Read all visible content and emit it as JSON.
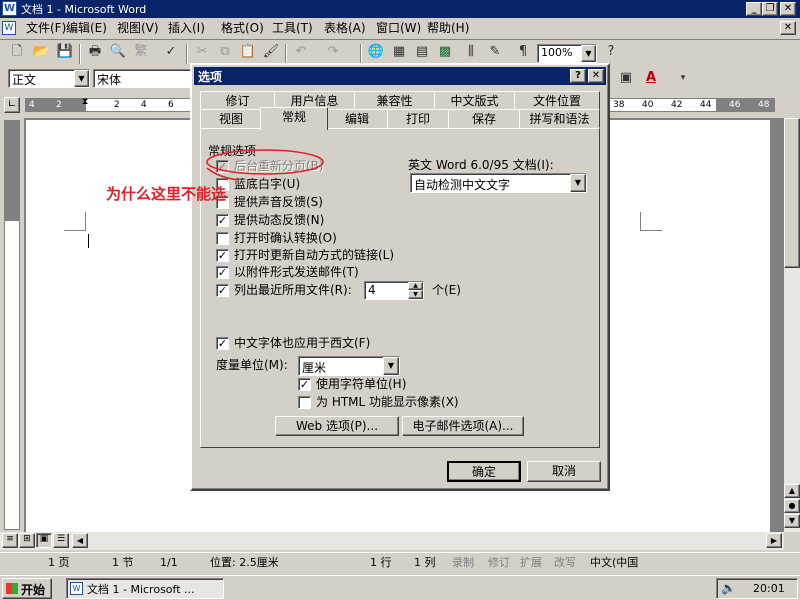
{
  "window": {
    "title": "文档 1 - Microsoft Word"
  },
  "menu": [
    "文件(F)",
    "编辑(E)",
    "视图(V)",
    "插入(I)",
    "格式(O)",
    "工具(T)",
    "表格(A)",
    "窗口(W)",
    "帮助(H)"
  ],
  "toolbar": {
    "zoom": "100%",
    "style": "正文",
    "font": "宋体"
  },
  "ruler": {
    "left_ticks": [
      "4",
      "2",
      "2",
      "4",
      "6"
    ],
    "right_ticks": [
      "38",
      "40",
      "42",
      "44",
      "46",
      "48"
    ]
  },
  "dialog": {
    "title": "选项",
    "tabs_back": [
      "修订",
      "用户信息",
      "兼容性",
      "中文版式",
      "文件位置"
    ],
    "tabs_front": [
      "视图",
      "常规",
      "编辑",
      "打印",
      "保存",
      "拼写和语法"
    ],
    "active_tab": "常规",
    "group_label": "常规选项",
    "options": [
      {
        "label": "后台重新分页(B)",
        "checked": true,
        "disabled": true
      },
      {
        "label": "蓝底白字(U)",
        "checked": false
      },
      {
        "label": "提供声音反馈(S)",
        "checked": false
      },
      {
        "label": "提供动态反馈(N)",
        "checked": true
      },
      {
        "label": "打开时确认转换(O)",
        "checked": false
      },
      {
        "label": "打开时更新自动方式的链接(L)",
        "checked": true
      },
      {
        "label": "以附件形式发送邮件(T)",
        "checked": true
      },
      {
        "label": "列出最近所用文件(R):",
        "checked": true
      }
    ],
    "recent_count": "4",
    "recent_unit": "个(E)",
    "word6_label": "英文 Word 6.0/95 文档(I):",
    "word6_value": "自动检测中文文字",
    "cjk_font_label": "中文字体也应用于西文(F)",
    "unit_label": "度量单位(M):",
    "unit_value": "厘米",
    "char_unit_label": "使用字符单位(H)",
    "html_pixels_label": "为 HTML 功能显示像素(X)",
    "web_options_button": "Web 选项(P)...",
    "email_options_button": "电子邮件选项(A)...",
    "ok_button": "确定",
    "cancel_button": "取消"
  },
  "annotation": {
    "text": "为什么这里不能选",
    "color": "#e0202a"
  },
  "status_bar": {
    "page": "1 页",
    "section": "1 节",
    "page_of": "1/1",
    "position": "位置: 2.5厘米",
    "line": "1 行",
    "column": "1 列",
    "rec": "录制",
    "trk": "修订",
    "ext": "扩展",
    "ovr": "改写",
    "lang": "中文(中国"
  },
  "taskbar": {
    "start": "开始",
    "task": "文档 1 - Microsoft ...",
    "time": "20:01"
  },
  "colors": {
    "titlebar": "#0a246a",
    "face": "#d4d0c8",
    "annotation": "#e0202a"
  }
}
